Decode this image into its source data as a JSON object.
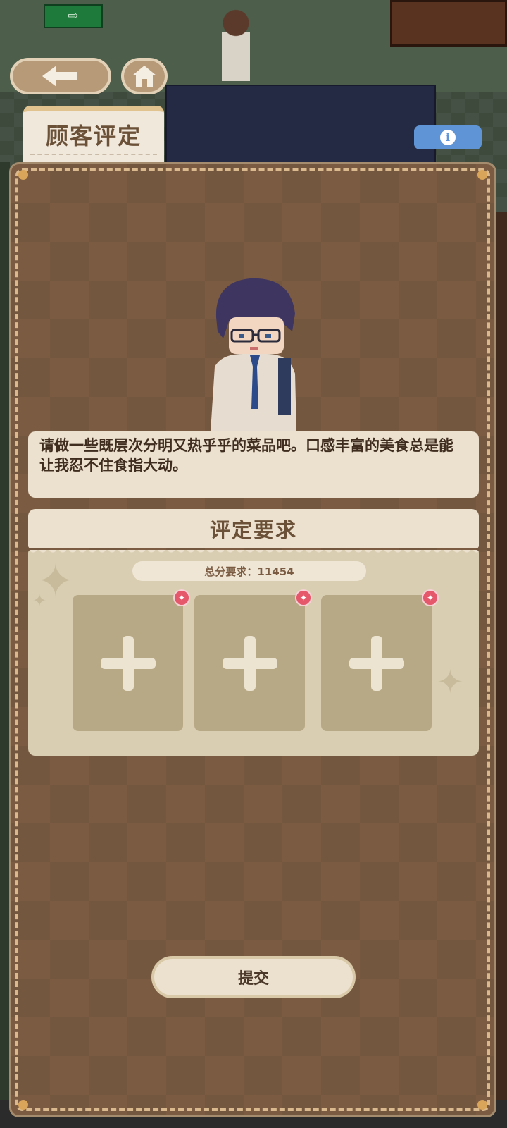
{
  "header": {
    "back_icon": "arrow-left-icon",
    "home_icon": "home-icon",
    "info_icon": "info-icon",
    "info_symbol": "i",
    "title": "顾客评定"
  },
  "customer": {
    "dialogue": "请做一些既层次分明又热乎乎的菜品吧。口感丰富的美食总是能让我忍不住食指大动。"
  },
  "requirements": {
    "heading": "评定要求",
    "score_requirement": "总分要求：11454",
    "slots": [
      {
        "icon": "plus-icon",
        "badge": "✦"
      },
      {
        "icon": "plus-icon",
        "badge": "✦"
      },
      {
        "icon": "plus-icon",
        "badge": "✦"
      }
    ]
  },
  "actions": {
    "submit_label": "提交"
  },
  "colors": {
    "panel": "#7b5c43",
    "panel_border": "#d9b98d",
    "info_button": "#5f94d6",
    "badge": "#e5586b"
  }
}
